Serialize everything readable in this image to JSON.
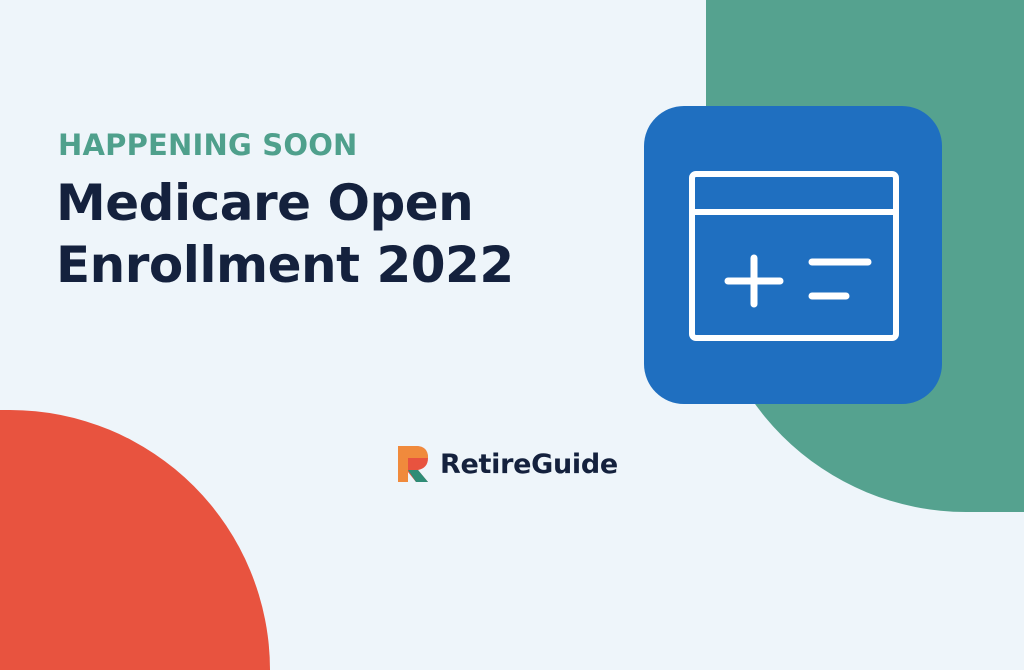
{
  "banner": {
    "eyebrow": "HAPPENING SOON",
    "headline_line1": "Medicare Open",
    "headline_line2": "Enrollment 2022"
  },
  "brand": {
    "name": "RetireGuide",
    "logo_icon": "retireguide-r-logo-icon"
  },
  "illustration": {
    "icon": "calculator-window-icon"
  },
  "colors": {
    "background": "#eef5fa",
    "green_accent": "#55a28f",
    "orange_accent": "#e8533f",
    "blue_tile": "#1f6fc0",
    "navy_text": "#14213d",
    "eyebrow_text": "#4fa08c"
  }
}
